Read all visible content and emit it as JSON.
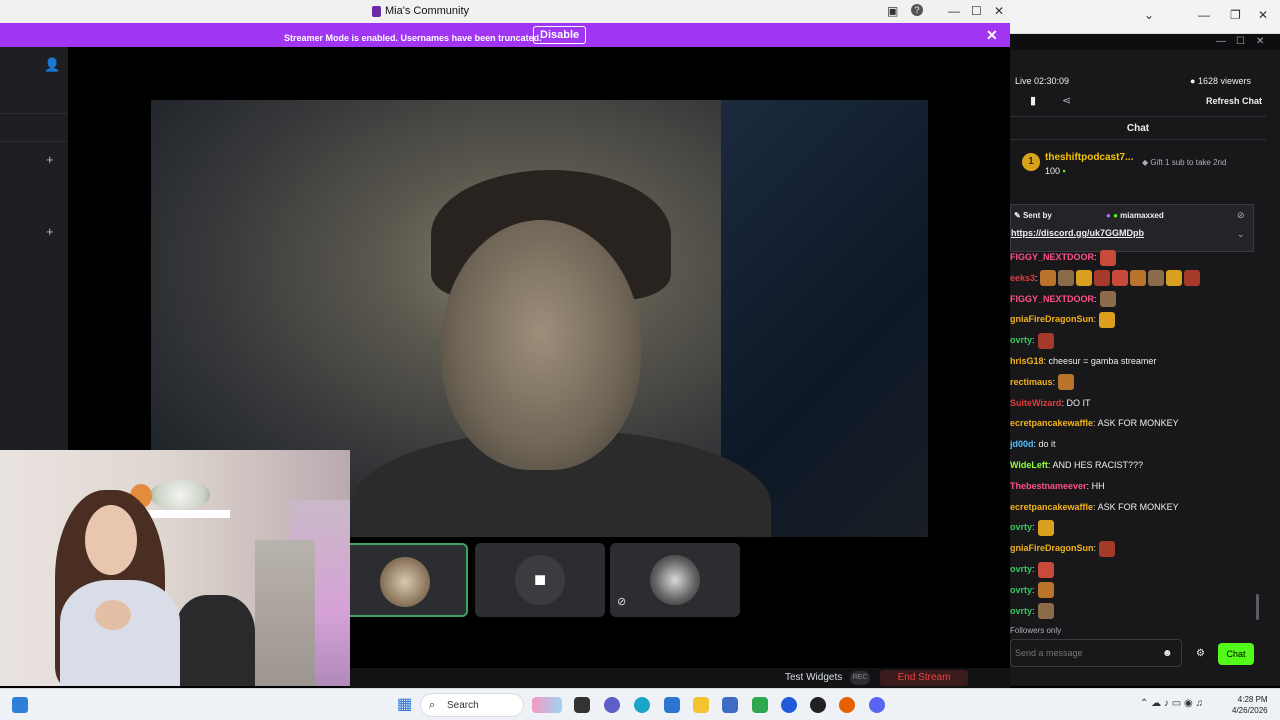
{
  "discord_window": {
    "title": "Mia's Community",
    "streamer_mode_message": "Streamer Mode is enabled. Usernames have been truncated.",
    "disable_label": "Disable",
    "test_widgets_label": "Test Widgets",
    "rec_label": "REC",
    "end_stream_label": "End Stream"
  },
  "twitch_chat": {
    "live_time": "Live 02:30:09",
    "viewers": "1628 viewers",
    "refresh_label": "Refresh Chat",
    "chat_header": "Chat",
    "gift": {
      "rank": "1",
      "username": "theshiftpodcast7...",
      "amount": "100",
      "cta": "Gift 1 sub to take 2nd"
    },
    "pinned": {
      "sent_by_label": "Sent by",
      "sender": "miamaxxed",
      "link": "https://discord.gg/uk7GGMDpb"
    },
    "messages": [
      {
        "user": "FIGGY_NEXTDOOR",
        "text": "",
        "color": "#ff4f8b",
        "emotes": 1
      },
      {
        "user": "eeks3",
        "text": "",
        "color": "#e53a3a",
        "emotes": 9
      },
      {
        "user": "FIGGY_NEXTDOOR",
        "text": "",
        "color": "#ff4f8b",
        "emotes": 1
      },
      {
        "user": "gniaFireDragonSun",
        "text": "",
        "color": "#f3b21b",
        "emotes": 1
      },
      {
        "user": "ovrty",
        "text": "",
        "color": "#34c759",
        "emotes": 1
      },
      {
        "user": "hrisG18",
        "text": " cheesur = gamba streamer",
        "color": "#f3b21b",
        "emotes": 0
      },
      {
        "user": "rectimaus",
        "text": "",
        "color": "#f3b21b",
        "emotes": 1
      },
      {
        "user": "SuiteWizard",
        "text": " DO IT",
        "color": "#e53a3a",
        "emotes": 0
      },
      {
        "user": "ecretpancakewaffle",
        "text": " ASK FOR MONKEY",
        "color": "#f3b21b",
        "emotes": 0
      },
      {
        "user": "jd00d",
        "text": " do it",
        "color": "#4fc3ff",
        "emotes": 0
      },
      {
        "user": "WideLeft",
        "text": " AND HES RACIST???",
        "color": "#8fff3a",
        "emotes": 0
      },
      {
        "user": "Thebestnameever",
        "text": " HH",
        "color": "#ff4f8b",
        "emotes": 0
      },
      {
        "user": "ecretpancakewaffle",
        "text": " ASK FOR MONKEY",
        "color": "#f3b21b",
        "emotes": 0
      },
      {
        "user": "ovrty",
        "text": "",
        "color": "#34c759",
        "emotes": 1
      },
      {
        "user": "gniaFireDragonSun",
        "text": "",
        "color": "#f3b21b",
        "emotes": 1
      },
      {
        "user": "ovrty",
        "text": "",
        "color": "#34c759",
        "emotes": 1
      },
      {
        "user": "ovrty",
        "text": "",
        "color": "#34c759",
        "emotes": 1
      },
      {
        "user": "ovrty",
        "text": "",
        "color": "#34c759",
        "emotes": 1
      }
    ],
    "followers_only": "Followers only",
    "input_placeholder": "Send a message",
    "send_label": "Chat"
  },
  "taskbar": {
    "search_label": "Search",
    "time": "4:28 PM",
    "date": "4/26/2026"
  },
  "colors": {
    "streamer_banner": "#a035f2",
    "twitch_accent": "#53fc18",
    "speaking_border": "#3ba55d"
  }
}
